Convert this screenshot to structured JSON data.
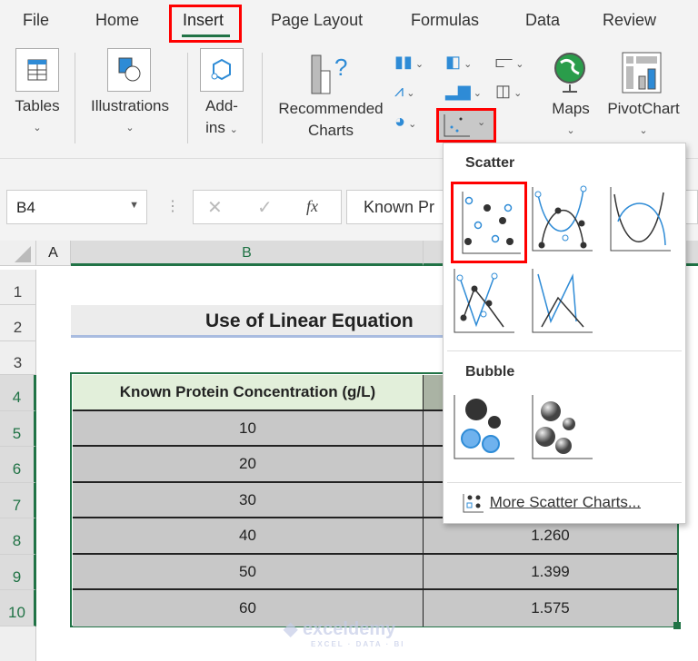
{
  "tabs": [
    "File",
    "Home",
    "Insert",
    "Page Layout",
    "Formulas",
    "Data",
    "Review"
  ],
  "active_tab": "Insert",
  "ribbon": {
    "tables": "Tables",
    "illustrations": "Illustrations",
    "addins_1": "Add-",
    "addins_2": "ins",
    "recommended_1": "Recommended",
    "recommended_2": "Charts",
    "maps": "Maps",
    "pivotchart": "PivotChart"
  },
  "formula_bar": {
    "name_box": "B4",
    "fx": "fx",
    "content": "Known Pr"
  },
  "columns": [
    "A",
    "B"
  ],
  "rows": [
    "1",
    "2",
    "3",
    "4",
    "5",
    "6",
    "7",
    "8",
    "9",
    "10"
  ],
  "sheet": {
    "title": "Use of Linear Equation",
    "header": "Known Protein Concentration (g/L)",
    "col_b": [
      "10",
      "20",
      "30",
      "40",
      "50",
      "60"
    ],
    "col_c": [
      "",
      "",
      "",
      "1.260",
      "1.399",
      "1.575"
    ]
  },
  "menu": {
    "scatter": "Scatter",
    "bubble": "Bubble",
    "more": "More Scatter Charts..."
  },
  "watermark": {
    "brand": "exceldemy",
    "tagline": "EXCEL · DATA · BI"
  },
  "colors": {
    "accent": "#217346",
    "highlight": "#ff0000",
    "chart_blue": "#2e8bd6"
  }
}
